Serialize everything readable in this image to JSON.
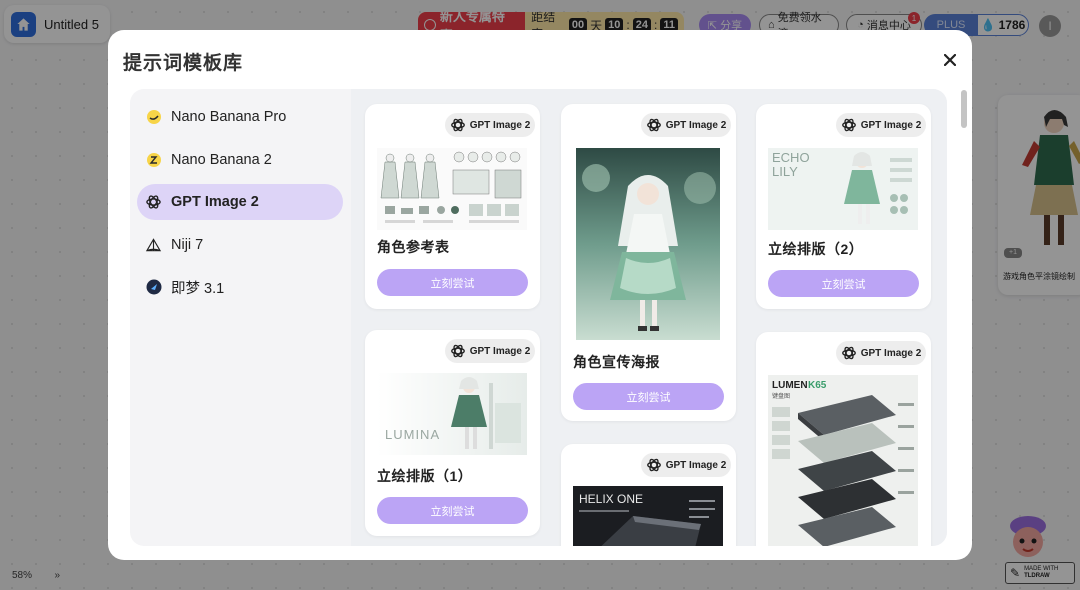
{
  "app": {
    "doc_title": "Untitled 5",
    "promo_label": "新人专属特惠",
    "countdown_label": "距结束",
    "countdown_days": "00",
    "countdown_day_unit": "天",
    "countdown_hours": "10",
    "countdown_minutes": "24",
    "countdown_seconds": "11",
    "share_label": "分享",
    "free_label": "免费领水滴",
    "messages_label": "消息中心",
    "messages_badge": "1",
    "plan_label": "PLUS",
    "credits": "1786",
    "avatar_initial": "I",
    "zoom_level": "58%",
    "side_card_chip": "+1",
    "side_card_caption": "游戏角色平涂镜绘制",
    "made_with_line1": "MADE WITH",
    "made_with_line2": "TLDRAW"
  },
  "modal": {
    "title": "提示词模板库",
    "models": [
      {
        "label": "Nano Banana Pro",
        "icon": "banana-pro-icon",
        "active": false
      },
      {
        "label": "Nano Banana 2",
        "icon": "banana-2-icon",
        "active": false
      },
      {
        "label": "GPT Image 2",
        "icon": "openai-icon",
        "active": true
      },
      {
        "label": "Niji 7",
        "icon": "niji-sail-icon",
        "active": false
      },
      {
        "label": "即梦 3.1",
        "icon": "jimeng-icon",
        "active": false
      }
    ],
    "cards": [
      {
        "badge": "GPT Image 2",
        "title": "角色参考表",
        "button": "立刻尝试"
      },
      {
        "badge": "GPT Image 2",
        "title": "角色宣传海报",
        "button": "立刻尝试"
      },
      {
        "badge": "GPT Image 2",
        "title": "立绘排版（2）",
        "button": "立刻尝试",
        "image_text_1": "ECHO",
        "image_text_2": "LILY"
      },
      {
        "badge": "GPT Image 2",
        "title": "立绘排版（1）",
        "button": "立刻尝试",
        "image_text": "LUMINA"
      },
      {
        "badge": "GPT Image 2",
        "title": "",
        "button": "",
        "image_text": "HELIX ONE"
      },
      {
        "badge": "GPT Image 2",
        "title": "",
        "button": "",
        "image_text_1": "LUMEN",
        "image_text_2": "K65",
        "image_text_3": "键盘图"
      }
    ]
  },
  "colors": {
    "accent_purple": "#bba4f5",
    "active_item_bg": "#ddd4f7",
    "promo_red": "#ef3e4b"
  }
}
